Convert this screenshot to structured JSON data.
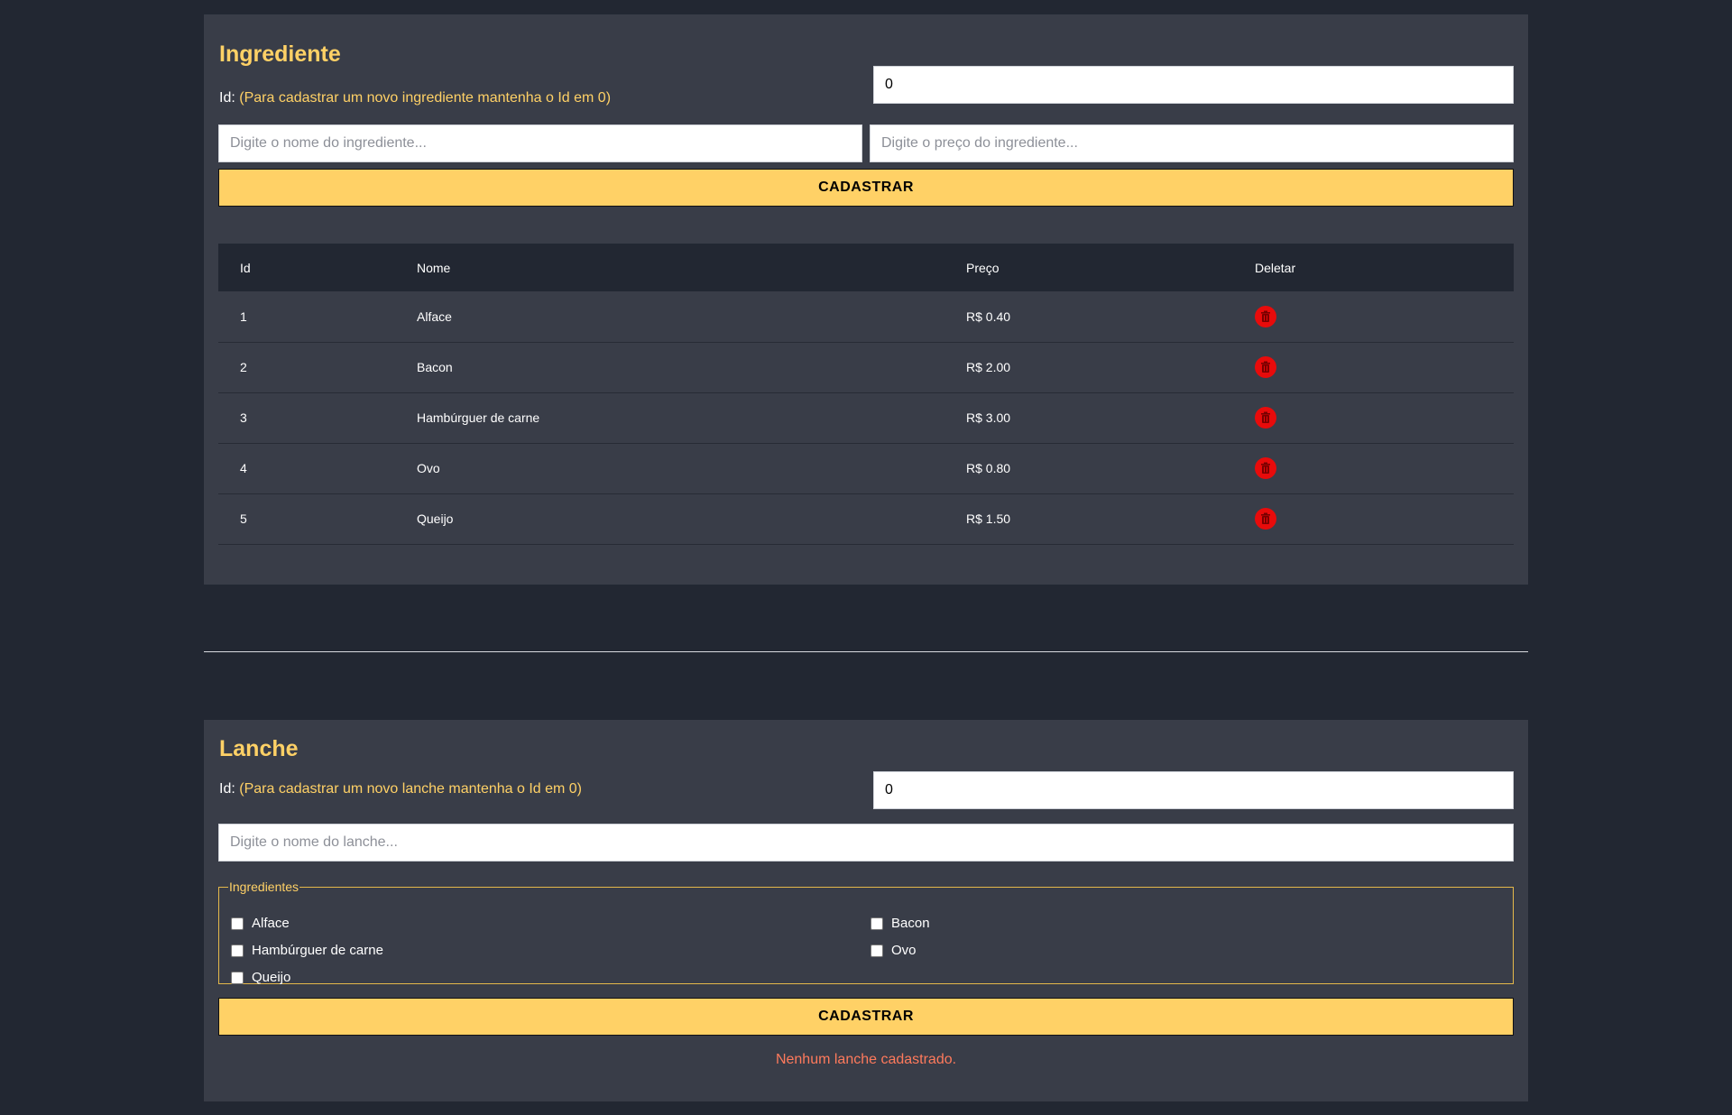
{
  "ingrediente": {
    "title": "Ingrediente",
    "id_label": "Id:",
    "id_hint": "(Para cadastrar um novo ingrediente mantenha o Id em 0)",
    "id_value": "0",
    "nome_placeholder": "Digite o nome do ingrediente...",
    "preco_placeholder": "Digite o preço do ingrediente...",
    "submit_label": "CADASTRAR",
    "table": {
      "headers": [
        "Id",
        "Nome",
        "Preço",
        "Deletar"
      ],
      "rows": [
        {
          "id": "1",
          "nome": "Alface",
          "preco": "R$ 0.40"
        },
        {
          "id": "2",
          "nome": "Bacon",
          "preco": "R$ 2.00"
        },
        {
          "id": "3",
          "nome": "Hambúrguer de carne",
          "preco": "R$ 3.00"
        },
        {
          "id": "4",
          "nome": "Ovo",
          "preco": "R$ 0.80"
        },
        {
          "id": "5",
          "nome": "Queijo",
          "preco": "R$ 1.50"
        }
      ],
      "delete_icon": "trash-icon"
    }
  },
  "lanche": {
    "title": "Lanche",
    "id_label": "Id:",
    "id_hint": "(Para cadastrar um novo lanche mantenha o Id em 0)",
    "id_value": "0",
    "nome_placeholder": "Digite o nome do lanche...",
    "ingredientes_legend": "Ingredientes",
    "ingredientes_options": [
      "Alface",
      "Bacon",
      "Hambúrguer de carne",
      "Ovo",
      "Queijo"
    ],
    "submit_label": "CADASTRAR",
    "empty_message": "Nenhum lanche cadastrado."
  },
  "colors": {
    "background": "#222732",
    "card": "#393d48",
    "accent": "#ffd166",
    "danger": "#e80b0b",
    "empty_message": "#ff7a5c"
  }
}
